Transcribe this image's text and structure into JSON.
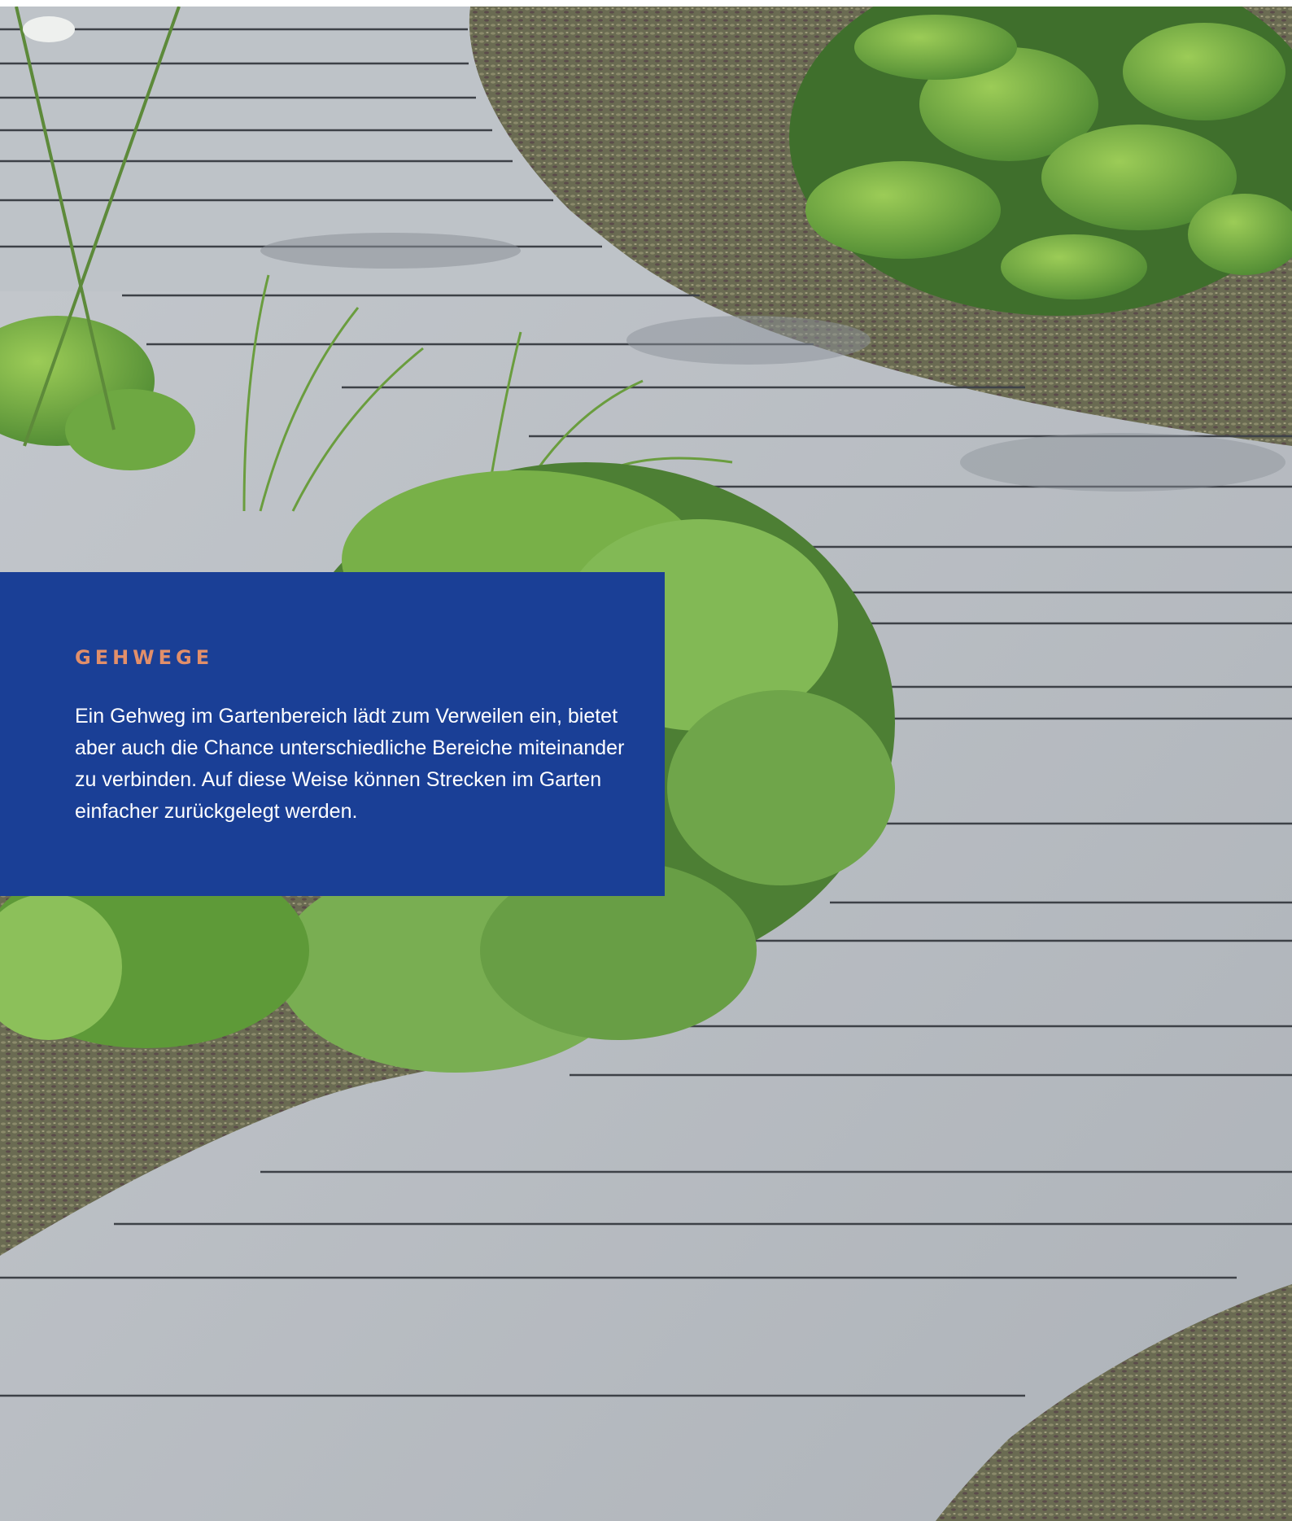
{
  "photo": {
    "subject": "garden-walkway-photo",
    "colors": {
      "path": "#b9bec4",
      "path_shadow": "#9ba1a8",
      "groove": "#3d4147",
      "ground_cover": "#6f6e55",
      "leaf_light": "#8fc04a",
      "leaf_mid": "#5e9a38",
      "leaf_dark": "#3f6f2c"
    }
  },
  "info": {
    "title": "GEHWEGE",
    "body": "Ein Gehweg im Gartenbereich lädt zum Verweilen ein, bietet aber auch die Chance unterschiedliche Bereiche miteinander zu verbinden. Auf diese Weise können Strecken im Garten einfacher zurückgelegt werden.",
    "colors": {
      "panel": "#1a3f96",
      "title": "#e28f6a",
      "text": "#ffffff"
    }
  }
}
